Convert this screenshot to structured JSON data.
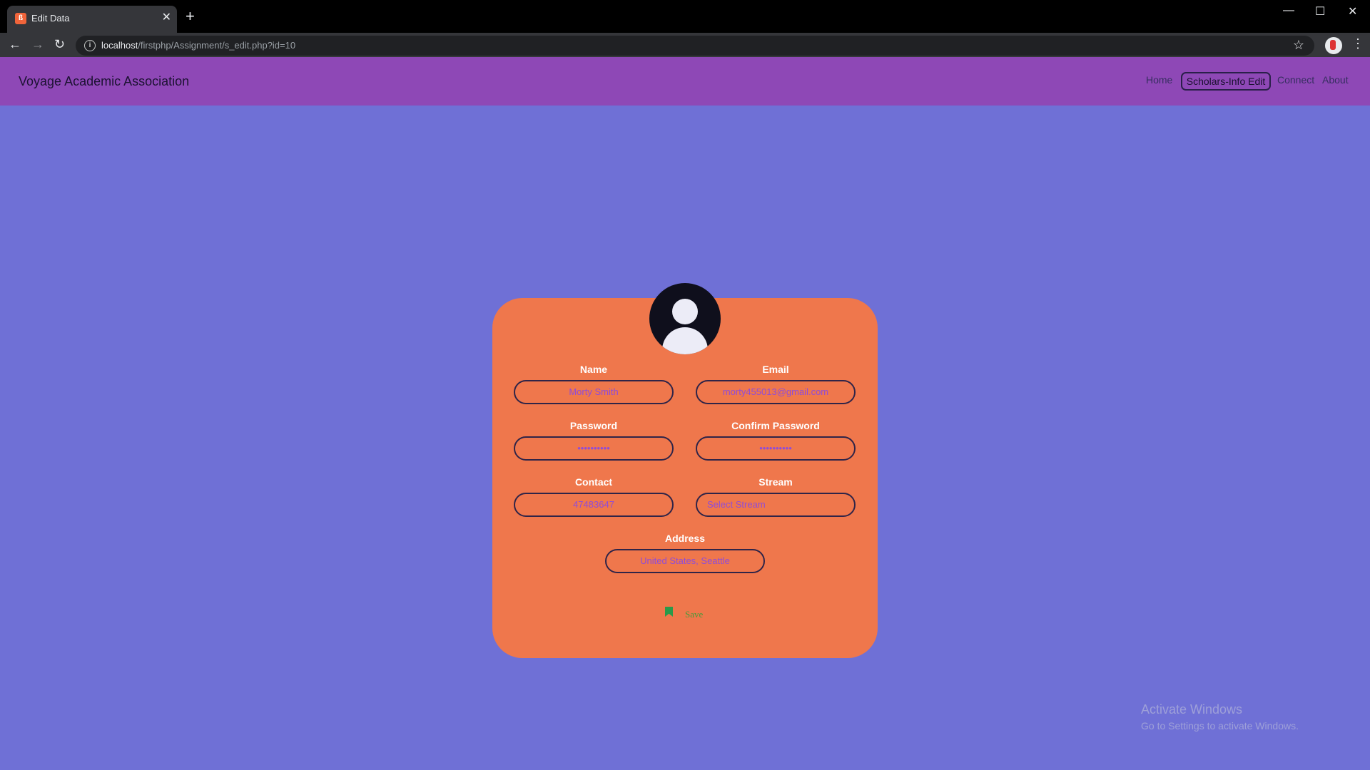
{
  "browser": {
    "tab_title": "Edit Data",
    "tab_favicon": "ß",
    "url_host": "localhost",
    "url_path": "/firstphp/Assignment/s_edit.php?id=10"
  },
  "site": {
    "brand": "Voyage Academic Association",
    "nav": [
      {
        "label": "Home"
      },
      {
        "label": "Scholars-Info Edit"
      },
      {
        "label": "Connect"
      },
      {
        "label": "About"
      }
    ]
  },
  "form": {
    "name": {
      "label": "Name",
      "value": "Morty Smith"
    },
    "email": {
      "label": "Email",
      "value": "morty455013@gmail.com"
    },
    "password": {
      "label": "Password",
      "value": "••••••••••"
    },
    "confirm_password": {
      "label": "Confirm Password",
      "value": "••••••••••"
    },
    "contact": {
      "label": "Contact",
      "value": "47483647"
    },
    "stream": {
      "label": "Stream",
      "value": "Select Stream"
    },
    "address": {
      "label": "Address",
      "value": "United States, Seattle"
    },
    "save_label": "Save"
  },
  "watermark": {
    "title": "Activate Windows",
    "subtitle": "Go to Settings to activate Windows."
  },
  "colors": {
    "page_bg": "#6f70d6",
    "navbar_bg": "#8e48b6",
    "card_bg": "#ef774c",
    "input_text": "#8f4cd8"
  }
}
